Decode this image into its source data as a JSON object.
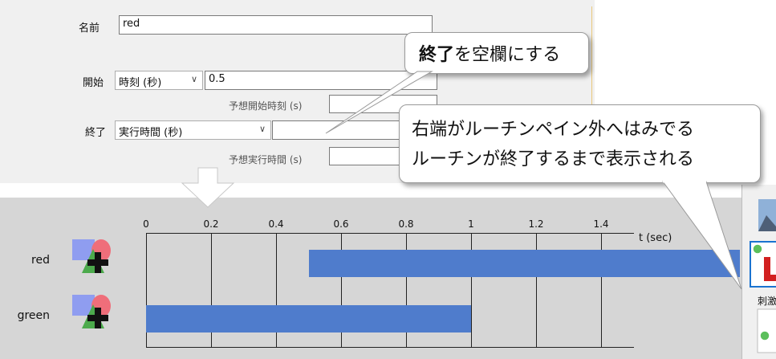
{
  "form": {
    "name_label": "名前",
    "name_value": "red",
    "start_label": "開始",
    "start_type": "時刻 (秒)",
    "start_value": "0.5",
    "expected_start_label": "予想開始時刻 (s)",
    "end_label": "終了",
    "end_type": "実行時間 (秒)",
    "end_value": "",
    "expected_duration_label": "予想実行時間 (s)"
  },
  "callouts": {
    "top_bold": "終了",
    "top_rest": "を空欄にする",
    "bottom_line1": "右端がルーチンペイン外へはみでる",
    "bottom_line2": "ルーチンが終了するまで表示される"
  },
  "right_panel": {
    "label": "刺激"
  },
  "chart_data": {
    "type": "bar",
    "x_ticks": [
      "0",
      "0.2",
      "0.4",
      "0.6",
      "0.8",
      "1",
      "1.2",
      "1.4"
    ],
    "xlabel": "t (sec)",
    "xlim": [
      0,
      1.4
    ],
    "categories": [
      "red",
      "green"
    ],
    "bars": [
      {
        "component": "red",
        "start": 0.5,
        "end": null
      },
      {
        "component": "green",
        "start": 0,
        "end": 1
      }
    ],
    "bar_color": "#4f7ccc"
  }
}
